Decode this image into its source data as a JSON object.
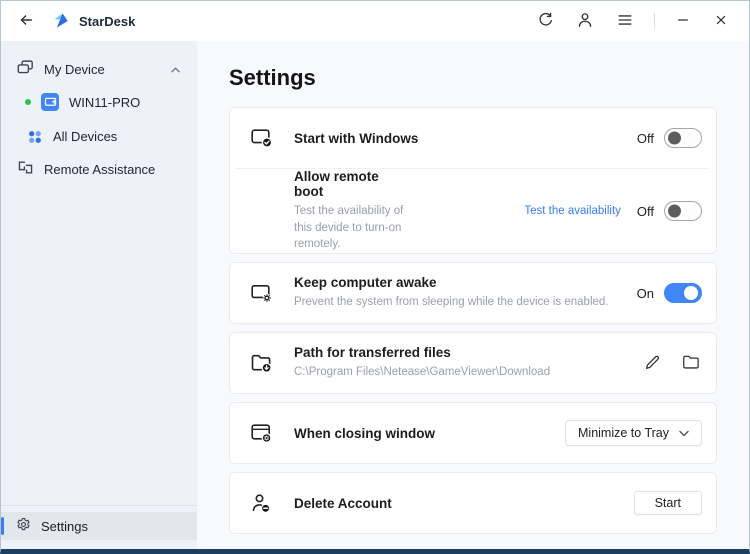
{
  "titlebar": {
    "app_name": "StarDesk"
  },
  "sidebar": {
    "items": [
      {
        "label": "My Device"
      },
      {
        "label": "WIN11-PRO",
        "status": "online"
      },
      {
        "label": "All Devices"
      },
      {
        "label": "Remote Assistance"
      }
    ],
    "settings_label": "Settings"
  },
  "main": {
    "title": "Settings",
    "start_with_windows": {
      "title": "Start with Windows",
      "state": "Off"
    },
    "allow_remote_boot": {
      "title": "Allow remote boot",
      "description": "Test the availability of this devide to turn-on remotely.",
      "link_label": "Test the availability",
      "state": "Off"
    },
    "keep_awake": {
      "title": "Keep computer awake",
      "description": "Prevent the system from sleeping while the device is enabled.",
      "state": "On"
    },
    "transfer_path": {
      "title": "Path for transferred files",
      "path": "C:\\Program Files\\Netease\\GameViewer\\Download"
    },
    "closing_window": {
      "title": "When closing window",
      "selected_option": "Minimize to Tray"
    },
    "delete_account": {
      "title": "Delete Account",
      "button_label": "Start"
    }
  },
  "colors": {
    "accent_blue": "#4285f4",
    "link_blue": "#3a7cf0",
    "online_green": "#2fbf4f",
    "window_bottom_edge": "#1c3e60"
  }
}
